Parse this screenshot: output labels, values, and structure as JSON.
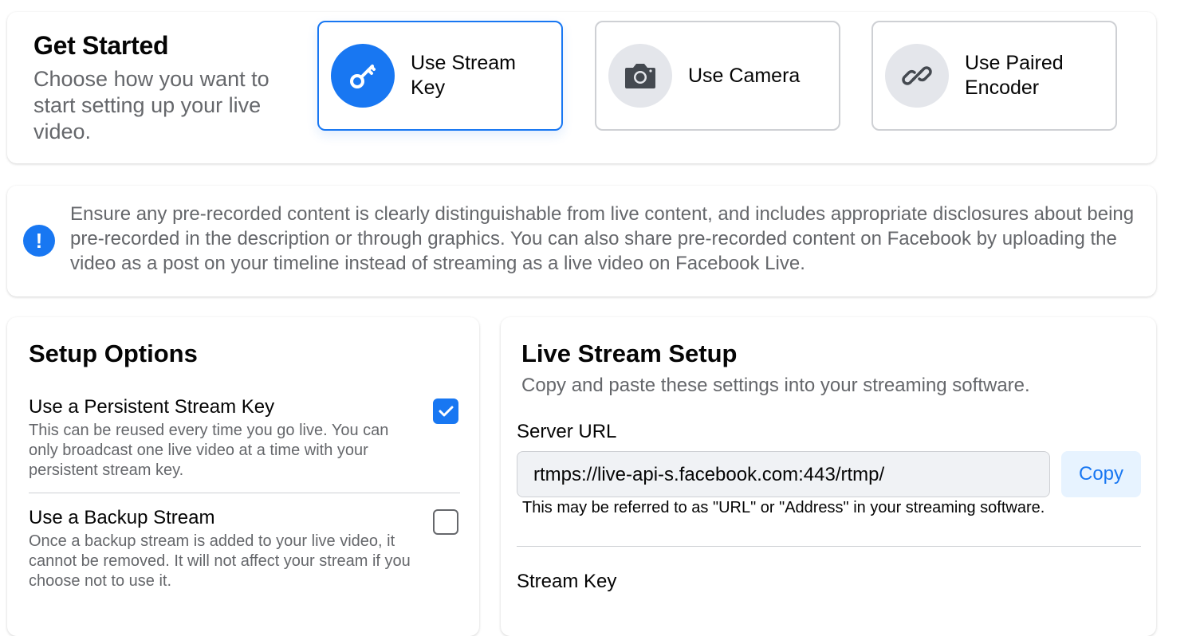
{
  "get_started": {
    "title": "Get Started",
    "description": "Choose how you want to start setting up your live video.",
    "options": [
      {
        "label": "Use Stream Key",
        "icon": "key-icon",
        "selected": true
      },
      {
        "label": "Use Camera",
        "icon": "camera-icon",
        "selected": false
      },
      {
        "label": "Use Paired Encoder",
        "icon": "link-icon",
        "selected": false
      }
    ]
  },
  "notice": {
    "icon": "exclamation-icon",
    "text": "Ensure any pre-recorded content is clearly distinguishable from live content, and includes appropriate disclosures about being pre-recorded in the description or through graphics. You can also share pre-recorded content on Facebook by uploading the video as a post on your timeline instead of streaming as a live video on Facebook Live."
  },
  "setup_options": {
    "title": "Setup Options",
    "persistent": {
      "title": "Use a Persistent Stream Key",
      "description": "This can be reused every time you go live. You can only broadcast one live video at a time with your persistent stream key.",
      "checked": true
    },
    "backup": {
      "title": "Use a Backup Stream",
      "description": "Once a backup stream is added to your live video, it cannot be removed. It will not affect your stream if you choose not to use it.",
      "checked": false
    }
  },
  "live_setup": {
    "title": "Live Stream Setup",
    "subtitle": "Copy and paste these settings into your streaming software.",
    "server_url_label": "Server URL",
    "server_url_value": "rtmps://live-api-s.facebook.com:443/rtmp/",
    "copy_label": "Copy",
    "server_url_hint": "This may be referred to as \"URL\" or \"Address\" in your streaming software.",
    "stream_key_label": "Stream Key"
  },
  "colors": {
    "accent": "#1877f2",
    "secondary_text": "#65676b",
    "border": "#ced0d4"
  }
}
